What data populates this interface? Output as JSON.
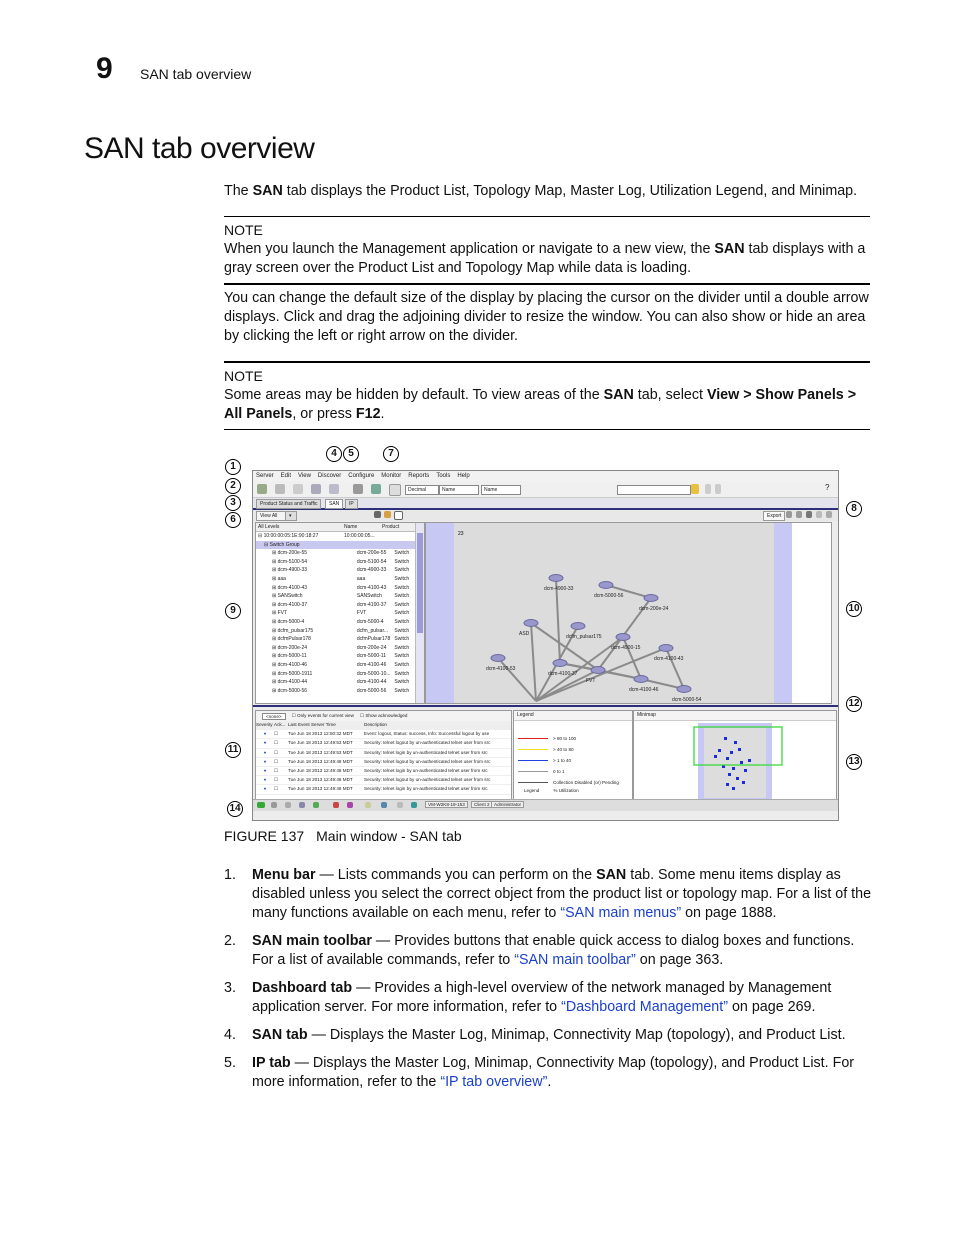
{
  "header": {
    "chapter_number": "9",
    "chapter_title": "SAN tab overview"
  },
  "page_title": "SAN tab overview",
  "intro": {
    "pre": "The ",
    "bold": "SAN",
    "post": " tab displays the Product List, Topology Map, Master Log, Utilization Legend, and Minimap."
  },
  "note1": {
    "heading": "NOTE",
    "pre": "When you launch the Management application or navigate to a new view, the ",
    "bold": "SAN",
    "post": " tab displays with a gray screen over the Product List and Topology Map while data is loading."
  },
  "paragraph2": "You can change the default size of the display by placing the cursor on the divider until a double arrow displays. Click and drag the adjoining divider to resize the window. You can also show or hide an area by clicking the left or right arrow on the divider.",
  "note2": {
    "heading": "NOTE",
    "t1": "Some areas may be hidden by default. To view areas of the ",
    "b1": "SAN",
    "t2": " tab, select ",
    "b2": "View > Show Panels > All Panels",
    "t3": ", or press ",
    "b3": "F12",
    "t4": "."
  },
  "figure": {
    "caption_label": "FIGURE 137",
    "caption_text": "Main window - SAN tab",
    "callouts": [
      "1",
      "2",
      "3",
      "4",
      "5",
      "6",
      "7",
      "8",
      "9",
      "10",
      "11",
      "12",
      "13",
      "14"
    ],
    "menu": [
      "Server",
      "Edit",
      "View",
      "Discover",
      "Configure",
      "Monitor",
      "Reports",
      "Tools",
      "Help"
    ],
    "toolbar_selects": [
      "Decimal",
      "Name",
      "Name"
    ],
    "help_label": "?",
    "tabs": [
      "Product Status and Traffic",
      "SAN",
      "IP"
    ],
    "view_all": "View All",
    "export_label": "Export",
    "product_list": {
      "headers": [
        "All Levels",
        "Name",
        "Product"
      ],
      "rows": [
        [
          "10:00:00:05:1E:90:18:27",
          "10:00:00:05...",
          ""
        ],
        [
          "Switch Group",
          "",
          ""
        ],
        [
          "dcm-200e-55",
          "dcm-200e-55",
          "Switch"
        ],
        [
          "dcm-5100-54",
          "dcm-5100-54",
          "Switch"
        ],
        [
          "dcm-4900-33",
          "dcm-4900-33",
          "Switch"
        ],
        [
          "aaa",
          "aaa",
          "Switch"
        ],
        [
          "dcm-4100-43",
          "dcm-4100-43",
          "Switch"
        ],
        [
          "SANSwitch",
          "SANSwitch",
          "Switch"
        ],
        [
          "dcm-4100-37",
          "dcm-4100-37",
          "Switch"
        ],
        [
          "FVT",
          "FVT",
          "Switch"
        ],
        [
          "dcm-5000-4",
          "dcm-5000-4",
          "Switch"
        ],
        [
          "dcfm_pulsar175",
          "dcfm_pulsar...",
          "Switch"
        ],
        [
          "dcfmPulsar178",
          "dcfmPulsar178",
          "Switch"
        ],
        [
          "dcm-200e-24",
          "dcm-200e-24",
          "Switch"
        ],
        [
          "dcm-5000-11",
          "dcm-5000-11",
          "Switch"
        ],
        [
          "dcm-4100-46",
          "dcm-4100-46",
          "Switch"
        ],
        [
          "dcm-5000-1911",
          "dcm-5000-10...",
          "Switch"
        ],
        [
          "dcm-4100-44",
          "dcm-4100-44",
          "Switch"
        ],
        [
          "dcm-5000-56",
          "dcm-5000-56",
          "Switch"
        ]
      ]
    },
    "topology": {
      "group_count": "23",
      "nodes": [
        {
          "label": "dcm-4900-33"
        },
        {
          "label": "dcm-5000-56"
        },
        {
          "label": "dcm-200e-24"
        },
        {
          "label": "ASD"
        },
        {
          "label": "dcfm_pulsar175"
        },
        {
          "label": "dcm-4900-15"
        },
        {
          "label": "dcm-4100-43"
        },
        {
          "label": "dcm-4100-53"
        },
        {
          "label": "dcm-4100-37"
        },
        {
          "label": "FVT"
        },
        {
          "label": "dcm-4100-46"
        },
        {
          "label": "dcm-5000-54"
        }
      ]
    },
    "master_log": {
      "filter": "<none>",
      "only_current": "Only events for current view",
      "show_ack": "Show acknowledged",
      "headers": [
        "Severity",
        "Ack...",
        "Last Event Server Time",
        "Description"
      ],
      "rows": [
        [
          "Tue Jun 18 2013 12:50:32 MDT",
          "Event: logout, Status: success, Info: Successful logout by use"
        ],
        [
          "Tue Jun 18 2013 12:49:53 MDT",
          "Security: telnet logout by un-authenticated telnet user from src"
        ],
        [
          "Tue Jun 18 2013 12:49:53 MDT",
          "Security: telnet login by un-authenticated telnet user from src"
        ],
        [
          "Tue Jun 18 2013 12:49:48 MDT",
          "Security: telnet logout by un-authenticated telnet user from src"
        ],
        [
          "Tue Jun 18 2013 12:49:48 MDT",
          "Security: telnet login by un-authenticated telnet user from src"
        ],
        [
          "Tue Jun 18 2013 12:49:46 MDT",
          "Security: telnet logout by un-authenticated telnet user from src"
        ],
        [
          "Tue Jun 18 2013 12:49:46 MDT",
          "Security: telnet login by un-authenticated telnet user from src"
        ]
      ]
    },
    "legend": {
      "title": "Legend",
      "items": [
        {
          "label": "> 80 to 100",
          "color": "#e02020"
        },
        {
          "label": "> 40 to 80",
          "color": "#f0e020"
        },
        {
          "label": "> 1 to 40",
          "color": "#2040e0"
        },
        {
          "label": "0 to 1",
          "color": "#999999"
        },
        {
          "label": "Collection Disabled (or) Pending",
          "color": "#555555"
        }
      ],
      "footer_left": "Legend",
      "footer_right": "% Utilization"
    },
    "minimap": {
      "title": "Minimap"
    },
    "status_bar": [
      "VM-W2K8-19-153",
      "Client 2",
      "Administrator"
    ]
  },
  "list_items": [
    {
      "num": "1.",
      "bold": "Menu bar",
      "text": " — Lists commands you can perform on the ",
      "b2": "SAN",
      "text2": " tab. Some menu items display as disabled unless you select the correct object from the product list or topology map. For a list of the many functions available on each menu, refer to ",
      "link": "“SAN main menus”",
      "tail": " on page 1888."
    },
    {
      "num": "2.",
      "bold": "SAN main toolbar",
      "text": " — Provides buttons that enable quick access to dialog boxes and functions. For a list of available commands, refer to ",
      "b2": "",
      "text2": "",
      "link": "“SAN main toolbar”",
      "tail": " on page 363."
    },
    {
      "num": "3.",
      "bold": "Dashboard tab",
      "text": " — Provides a high-level overview of the network managed by Management application server. For more information, refer to ",
      "b2": "",
      "text2": "",
      "link": "“Dashboard Management”",
      "tail": " on page 269."
    },
    {
      "num": "4.",
      "bold": "SAN tab",
      "text": " — Displays the Master Log, Minimap, Connectivity Map (topology), and Product List.",
      "b2": "",
      "text2": "",
      "link": "",
      "tail": ""
    },
    {
      "num": "5.",
      "bold": "IP tab",
      "text": " — Displays the Master Log, Minimap, Connectivity Map (topology), and Product List. For more information, refer to the ",
      "b2": "",
      "text2": "",
      "link": "“IP tab overview”",
      "tail": "."
    }
  ]
}
